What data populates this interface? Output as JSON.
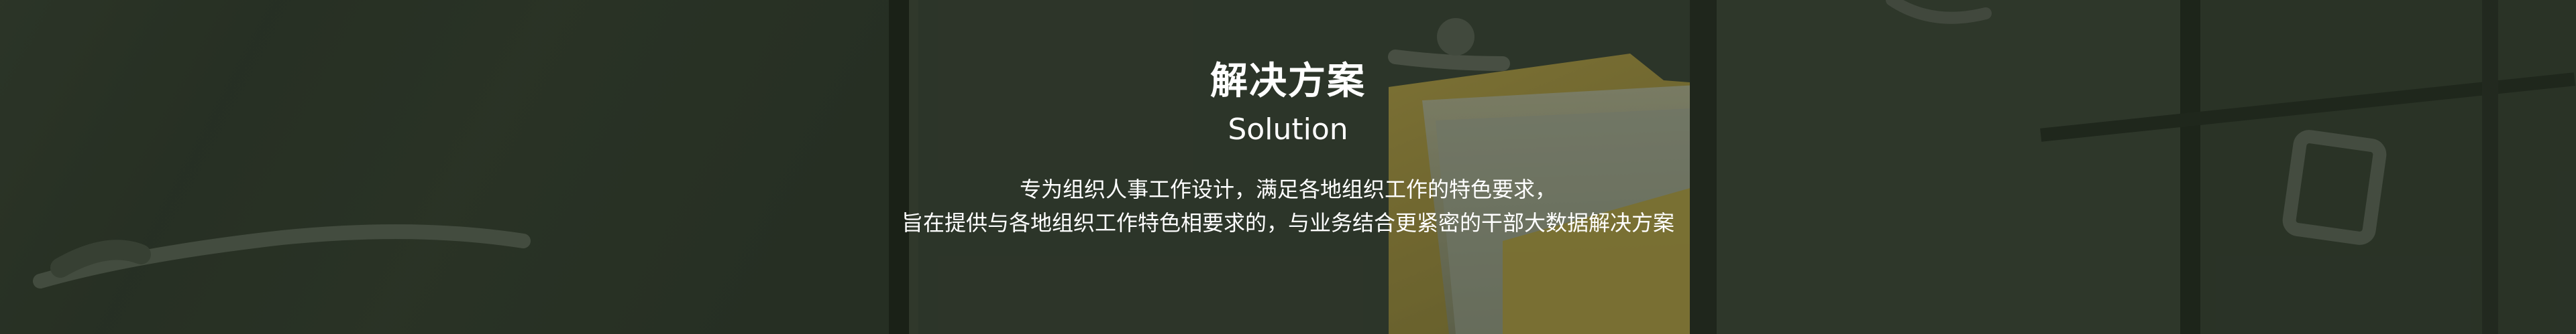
{
  "banner": {
    "title": "解决方案",
    "subtitle": "Solution",
    "description": [
      "专为组织人事工作设计，满足各地组织工作的特色要求，",
      "旨在提供与各地组织工作特色相要求的，与业务结合更紧密的干部大数据解决方案"
    ],
    "background_image": "file-cabinet-drawers-with-folder",
    "colors": {
      "text": "#ffffff",
      "overlay": "#1c2418",
      "folder": "#bfa544"
    }
  }
}
